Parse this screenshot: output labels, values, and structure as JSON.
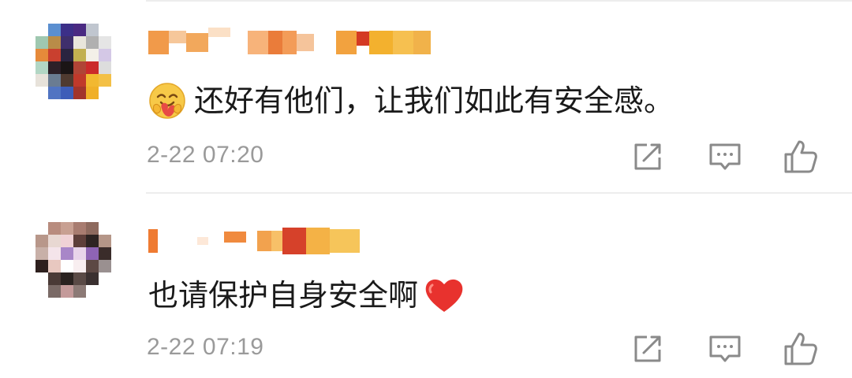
{
  "comments": [
    {
      "username_masked": "",
      "emoji_icon": "hugging-face-emoji",
      "text": "还好有他们，让我们如此有安全感。",
      "time": "2-22 07:20",
      "trailing_icon": ""
    },
    {
      "username_masked": "",
      "emoji_icon": "",
      "text": "也请保护自身安全啊",
      "time": "2-22 07:19",
      "trailing_icon": "red-heart-emoji"
    }
  ],
  "actions": {
    "share_icon": "share-icon",
    "comment_icon": "comment-icon",
    "like_icon": "thumbs-up-icon"
  },
  "colors": {
    "divider": "#ededed",
    "time_text": "#9a9a9a",
    "icon_stroke": "#8a8a8a",
    "heart": "#e8322e"
  }
}
